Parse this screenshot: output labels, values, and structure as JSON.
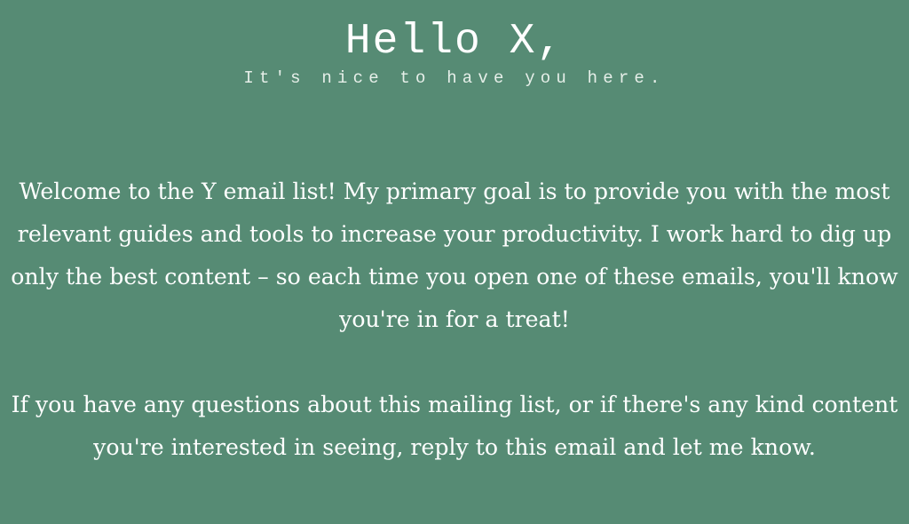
{
  "header": {
    "title": "Hello X,",
    "subtitle": "It's nice to have you here."
  },
  "body": {
    "paragraphs": [
      "Welcome to the Y email list! My primary goal is to provide you with the most relevant guides and tools to increase your productivity. I work hard to dig up only the best content – so each time you open one of these emails, you'll know you're in for a treat!",
      "If you have any questions about this mailing list, or if there's any kind content you're interested in seeing, reply to this email and let me know."
    ]
  },
  "colors": {
    "background": "#568b74",
    "text": "#ffffff"
  }
}
